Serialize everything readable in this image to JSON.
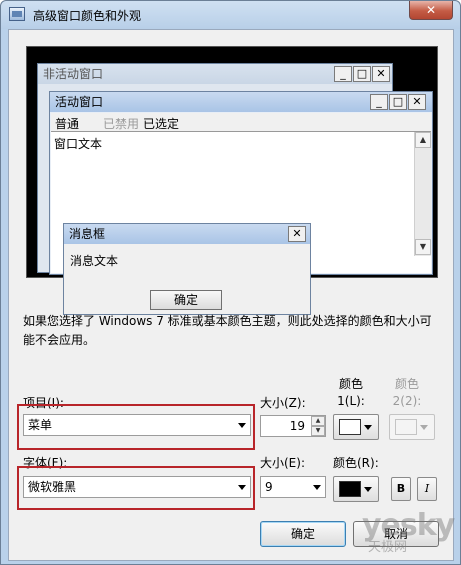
{
  "window": {
    "title": "高级窗口颜色和外观",
    "close_glyph": "✕",
    "icon": "app-appearance-icon"
  },
  "preview": {
    "inactive_title": "非活动窗口",
    "active_title": "活动窗口",
    "menu": [
      "普通",
      "已禁用",
      "已选定"
    ],
    "window_text": "窗口文本",
    "message_box_title": "消息框",
    "message_text": "消息文本",
    "ok_label": "确定",
    "caption_glyphs": {
      "minimize": "_",
      "maximize": "□",
      "close": "✕"
    }
  },
  "description": "如果您选择了 Windows 7 标准或基本颜色主题，则此处选择的颜色和大小可能不会应用。",
  "item": {
    "label": "项目(I):",
    "value": "菜单",
    "size_label": "大小(Z):",
    "size_value": "19",
    "color1_label": "颜色 1(L):",
    "color2_label": "颜色 2(2):",
    "color1": "#ffffff"
  },
  "font": {
    "label": "字体(F):",
    "value": "微软雅黑",
    "size_label": "大小(E):",
    "size_value": "9",
    "color_label": "颜色(R):",
    "color": "#000000",
    "bold_label": "B",
    "italic_label": "I"
  },
  "buttons": {
    "ok": "确定",
    "cancel": "取消"
  },
  "watermark": {
    "text": "yesky",
    "subtext": "天极网"
  },
  "highlight_color": "#b8252a"
}
